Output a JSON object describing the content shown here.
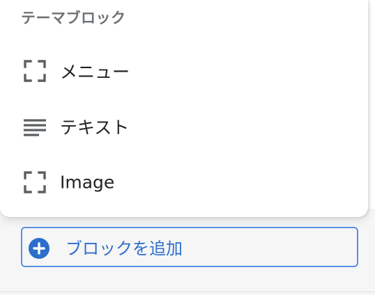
{
  "popover": {
    "section_title": "テーマブロック",
    "items": [
      {
        "label": "メニュー",
        "icon": "frame-corners-icon"
      },
      {
        "label": "テキスト",
        "icon": "text-align-icon"
      },
      {
        "label": "Image",
        "icon": "frame-corners-icon"
      }
    ]
  },
  "add_block": {
    "label": "ブロックを追加",
    "icon": "circle-plus-icon"
  },
  "colors": {
    "accent": "#2c6ecb",
    "focus_border": "#5c8ee3",
    "text": "#202223",
    "subdued": "#6d7175",
    "icon": "#5c5f62"
  }
}
